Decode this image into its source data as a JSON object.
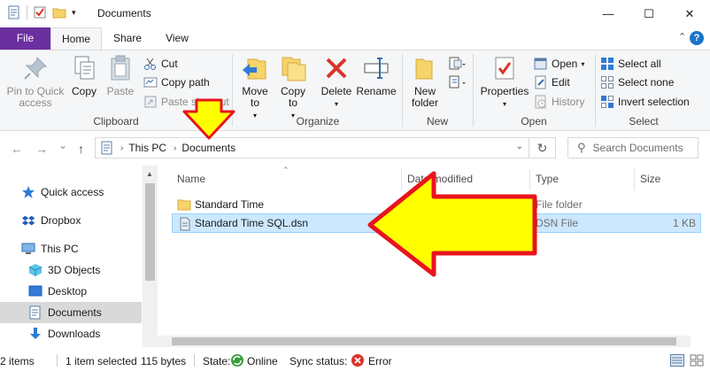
{
  "window": {
    "title": "Documents",
    "minimize_glyph": "—",
    "maximize_glyph": "☐",
    "close_glyph": "✕"
  },
  "ribbon_tabs": {
    "file": "File",
    "home": "Home",
    "share": "Share",
    "view": "View",
    "collapse_glyph": "⌃",
    "help_glyph": "?"
  },
  "ribbon": {
    "clipboard": {
      "label": "Clipboard",
      "pin_to_quick_access": "Pin to Quick access",
      "copy": "Copy",
      "paste": "Paste",
      "cut": "Cut",
      "copy_path": "Copy path",
      "paste_shortcut": "Paste shortcut"
    },
    "organize": {
      "label": "Organize",
      "move_to": "Move to",
      "copy_to": "Copy to",
      "delete": "Delete",
      "rename": "Rename"
    },
    "new": {
      "label": "New",
      "new_folder": "New folder"
    },
    "open": {
      "label": "Open",
      "properties": "Properties",
      "open": "Open",
      "edit": "Edit",
      "history": "History"
    },
    "select": {
      "label": "Select",
      "select_all": "Select all",
      "select_none": "Select none",
      "invert_selection": "Invert selection"
    }
  },
  "address": {
    "back_glyph": "←",
    "forward_glyph": "→",
    "recent_glyph": "⌄",
    "up_glyph": "↑",
    "path": [
      "This PC",
      "Documents"
    ],
    "refresh_glyph": "↻",
    "search_placeholder": "Search Documents"
  },
  "nav_pane": {
    "items": [
      {
        "label": "Quick access"
      },
      {
        "label": "Dropbox"
      },
      {
        "label": "This PC"
      },
      {
        "label": "3D Objects"
      },
      {
        "label": "Desktop"
      },
      {
        "label": "Documents"
      },
      {
        "label": "Downloads"
      }
    ]
  },
  "file_list": {
    "columns": {
      "name": "Name",
      "date_modified": "Date modified",
      "type": "Type",
      "size": "Size"
    },
    "rows": [
      {
        "name": "Standard Time",
        "type": "File folder",
        "size": ""
      },
      {
        "name": "Standard Time SQL.dsn",
        "type": "DSN File",
        "size": "1 KB"
      }
    ]
  },
  "status_bar": {
    "item_count": "2 items",
    "selection": "1 item selected",
    "selection_size": "115 bytes",
    "state_label": "State:",
    "state_value": "Online",
    "sync_label": "Sync status:",
    "sync_value": "Error"
  },
  "colors": {
    "file_tab": "#6b2fa0",
    "selection_bg": "#cce8ff",
    "annotation_fill": "#ffff00",
    "annotation_stroke": "#e8141c",
    "sync_error": "#d9342b",
    "state_online": "#3a9e3a"
  }
}
